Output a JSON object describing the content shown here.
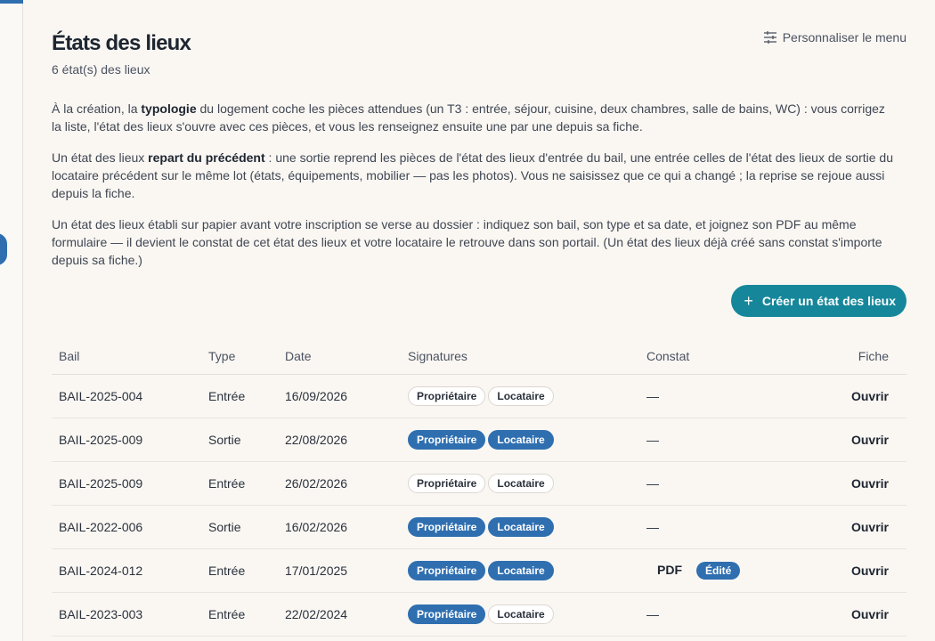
{
  "header": {
    "title": "États des lieux",
    "count": "6 état(s) des lieux",
    "customize_label": "Personnaliser le menu"
  },
  "intro": {
    "p1_a": "À la création, la ",
    "p1_b": "typologie",
    "p1_c": " du logement coche les pièces attendues (un T3 : entrée, séjour, cuisine, deux chambres, salle de bains, WC) : vous corrigez la liste, l'état des lieux s'ouvre avec ces pièces, et vous les renseignez ensuite une par une depuis sa fiche.",
    "p2_a": "Un état des lieux ",
    "p2_b": "repart du précédent",
    "p2_c": " : une sortie reprend les pièces de l'état des lieux d'entrée du bail, une entrée celles de l'état des lieux de sortie du locataire précédent sur le même lot (états, équipements, mobilier — pas les photos). Vous ne saisissez que ce qui a changé ; la reprise se rejoue aussi depuis la fiche.",
    "p3": "Un état des lieux établi sur papier avant votre inscription se verse au dossier : indiquez son bail, son type et sa date, et joignez son PDF au même formulaire — il devient le constat de cet état des lieux et votre locataire le retrouve dans son portail. (Un état des lieux déjà créé sans constat s'importe depuis sa fiche.)"
  },
  "create_button": {
    "label": "Créer un état des lieux",
    "icon": "plus-icon"
  },
  "table": {
    "headers": {
      "bail": "Bail",
      "type": "Type",
      "date": "Date",
      "signatures": "Signatures",
      "constat": "Constat",
      "fiche": "Fiche"
    },
    "sig_owner": "Propriétaire",
    "sig_tenant": "Locataire",
    "open_label": "Ouvrir",
    "rows": [
      {
        "bail": "BAIL-2025-004",
        "type": "Entrée",
        "date": "16/09/2026",
        "owner_signed": false,
        "tenant_signed": false,
        "constat": "—"
      },
      {
        "bail": "BAIL-2025-009",
        "type": "Sortie",
        "date": "22/08/2026",
        "owner_signed": true,
        "tenant_signed": true,
        "constat": "—"
      },
      {
        "bail": "BAIL-2025-009",
        "type": "Entrée",
        "date": "26/02/2026",
        "owner_signed": false,
        "tenant_signed": false,
        "constat": "—"
      },
      {
        "bail": "BAIL-2022-006",
        "type": "Sortie",
        "date": "16/02/2026",
        "owner_signed": true,
        "tenant_signed": true,
        "constat": "—"
      },
      {
        "bail": "BAIL-2024-012",
        "type": "Entrée",
        "date": "17/01/2025",
        "owner_signed": true,
        "tenant_signed": true,
        "constat": "PDF",
        "constat_badge": "Édité"
      },
      {
        "bail": "BAIL-2023-003",
        "type": "Entrée",
        "date": "22/02/2024",
        "owner_signed": true,
        "tenant_signed": false,
        "constat": "—"
      }
    ]
  },
  "colors": {
    "accent_blue": "#2f6fb0",
    "teal": "#16879b",
    "background": "#faf7f3"
  }
}
